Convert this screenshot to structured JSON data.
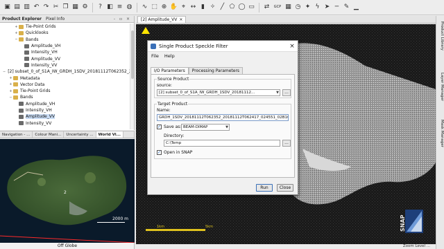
{
  "toolbar": {
    "icons": [
      "new-product-icon",
      "open-icon",
      "save-icon",
      "undo-icon",
      "redo-icon",
      "cut-icon",
      "copy-icon",
      "paste-icon",
      "preferences-icon",
      "help-icon",
      "palette-icon",
      "layers-icon",
      "globe-icon",
      "wave-icon",
      "select-tool-icon",
      "zoom-icon",
      "pan-icon",
      "pin-icon",
      "range-icon",
      "histogram-icon",
      "magic-wand-icon",
      "draw-line-icon",
      "polygon-icon",
      "ellipse-icon",
      "rectangle-icon",
      "sync-icon",
      "gcp-icon",
      "grid-icon",
      "time-series-icon",
      "gcp-tool-icon",
      "flash-icon",
      "pointer-icon",
      "line-icon",
      "pencil-icon",
      "minimize-icon"
    ],
    "gcp_label": "GCP"
  },
  "left_top": {
    "tabs": [
      "Product Explorer",
      "Pixel Info"
    ],
    "controls": "- ▫ ×",
    "tree": [
      {
        "indent": 2,
        "exp": "+",
        "icon": "folder",
        "label": "Tie-Point Grids"
      },
      {
        "indent": 2,
        "exp": "+",
        "icon": "folder",
        "label": "Quicklooks"
      },
      {
        "indent": 2,
        "exp": "−",
        "icon": "folder",
        "label": "Bands"
      },
      {
        "indent": 3,
        "exp": "",
        "icon": "band",
        "label": "Amplitude_VH"
      },
      {
        "indent": 3,
        "exp": "",
        "icon": "band",
        "label": "Intensity_VH"
      },
      {
        "indent": 3,
        "exp": "",
        "icon": "band",
        "label": "Amplitude_VV"
      },
      {
        "indent": 3,
        "exp": "",
        "icon": "band",
        "label": "Intensity_VV"
      },
      {
        "indent": 0,
        "exp": "−",
        "icon": "prod",
        "label": "[2] subset_0_of_S1A_IW_GRDH_1SDV_20181112T062352_2018111"
      },
      {
        "indent": 1,
        "exp": "+",
        "icon": "folder",
        "label": "Metadata"
      },
      {
        "indent": 1,
        "exp": "+",
        "icon": "folder",
        "label": "Vector Data"
      },
      {
        "indent": 1,
        "exp": "+",
        "icon": "folder",
        "label": "Tie-Point Grids"
      },
      {
        "indent": 1,
        "exp": "−",
        "icon": "folder",
        "label": "Bands"
      },
      {
        "indent": 2,
        "exp": "",
        "icon": "band",
        "label": "Amplitude_VH"
      },
      {
        "indent": 2,
        "exp": "",
        "icon": "band",
        "label": "Intensity_VH"
      },
      {
        "indent": 2,
        "exp": "",
        "icon": "band",
        "label": "Amplitude_VV",
        "selected": true
      },
      {
        "indent": 2,
        "exp": "",
        "icon": "band",
        "label": "Intensity_VV"
      }
    ]
  },
  "left_bottom": {
    "tabs": [
      "Navigation - ...",
      "Colour Mani...",
      "Uncertainty ...",
      "World Vi..."
    ],
    "active_tab": 3,
    "scale_label": "2000 m",
    "marker_label": "2",
    "footer": "Off Globe"
  },
  "image_view": {
    "tab_label": "[2] Amplitude_VV",
    "tab_close": "×",
    "logo_text": "SNAP",
    "scale_labels": [
      "1km",
      "5km"
    ]
  },
  "status": {
    "text": "Zoom  Level ..."
  },
  "right_rail": [
    "Product Library",
    "Layer Manager",
    "Mask Manager"
  ],
  "dialog": {
    "title": "Single Product Speckle Filter",
    "close": "×",
    "menu": [
      "File",
      "Help"
    ],
    "tabs": [
      "I/O Parameters",
      "Processing Parameters"
    ],
    "source_group": "Source Product",
    "source_label": "source:",
    "source_value": "[2] subset_0_of_S1A_IW_GRDH_1SDV_20181112...",
    "browse": "...",
    "target_group": "Target Product",
    "name_label": "Name:",
    "name_value": "GRDH_1SDV_20181112T062352_20181112T062417_024551_02B1C4_894F_Spk",
    "save_as_label": "Save as:",
    "save_as_checked": true,
    "format": "BEAM-DIMAP",
    "directory_label": "Directory:",
    "directory_value": "C:\\Temp",
    "open_in_snap_label": "Open in SNAP",
    "open_in_snap_checked": true,
    "run": "Run",
    "close_btn": "Close"
  }
}
